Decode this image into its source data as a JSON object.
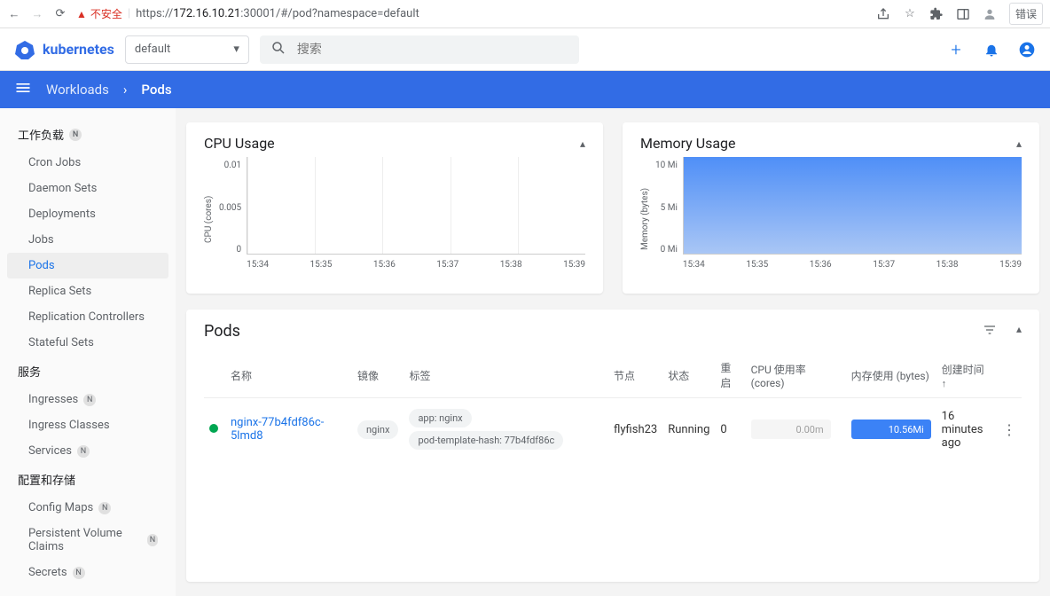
{
  "browser": {
    "insecure_label": "不安全",
    "url_prefix": "https://",
    "url_host": "172.16.10.21",
    "url_port_path": ":30001/#/pod?namespace=default",
    "error_btn": "错误"
  },
  "header": {
    "brand": "kubernetes",
    "namespace": "default",
    "search_placeholder": "搜索"
  },
  "breadcrumb": {
    "workloads": "Workloads",
    "current": "Pods"
  },
  "sidebar": {
    "sections": [
      {
        "title": "工作负载",
        "badge": "N",
        "items": [
          {
            "label": "Cron Jobs"
          },
          {
            "label": "Daemon Sets"
          },
          {
            "label": "Deployments"
          },
          {
            "label": "Jobs"
          },
          {
            "label": "Pods",
            "active": true
          },
          {
            "label": "Replica Sets"
          },
          {
            "label": "Replication Controllers"
          },
          {
            "label": "Stateful Sets"
          }
        ]
      },
      {
        "title": "服务",
        "items": [
          {
            "label": "Ingresses",
            "badge": "N"
          },
          {
            "label": "Ingress Classes"
          },
          {
            "label": "Services",
            "badge": "N"
          }
        ]
      },
      {
        "title": "配置和存储",
        "items": [
          {
            "label": "Config Maps",
            "badge": "N"
          },
          {
            "label": "Persistent Volume Claims",
            "badge": "N"
          },
          {
            "label": "Secrets",
            "badge": "N"
          }
        ]
      }
    ]
  },
  "chart_data": [
    {
      "type": "area",
      "title": "CPU Usage",
      "ylabel": "CPU (cores)",
      "x": [
        "15:34",
        "15:35",
        "15:36",
        "15:37",
        "15:38",
        "15:39"
      ],
      "y_ticks": [
        "0.01",
        "0.005",
        "0"
      ],
      "series": [
        {
          "name": "cpu",
          "values": [
            0,
            0,
            0,
            0,
            0,
            0
          ]
        }
      ],
      "ylim": [
        0,
        0.01
      ]
    },
    {
      "type": "area",
      "title": "Memory Usage",
      "ylabel": "Memory (bytes)",
      "x": [
        "15:34",
        "15:35",
        "15:36",
        "15:37",
        "15:38",
        "15:39"
      ],
      "y_ticks": [
        "10 Mi",
        "5 Mi",
        "0 Mi"
      ],
      "series": [
        {
          "name": "memory",
          "values": [
            10,
            10,
            10,
            10,
            10,
            10
          ]
        }
      ],
      "ylim": [
        0,
        10
      ]
    }
  ],
  "pods_table": {
    "title": "Pods",
    "headers": {
      "name": "名称",
      "image": "镜像",
      "labels": "标签",
      "node": "节点",
      "status": "状态",
      "restarts": "重启",
      "cpu": "CPU 使用率 (cores)",
      "mem": "内存使用 (bytes)",
      "created": "创建时间"
    },
    "rows": [
      {
        "name": "nginx-77b4fdf86c-5lmd8",
        "image": "nginx",
        "labels": [
          "app: nginx",
          "pod-template-hash: 77b4fdf86c"
        ],
        "node": "flyfish23",
        "status": "Running",
        "restarts": "0",
        "cpu": "0.00m",
        "mem": "10.56Mi",
        "created": "16 minutes ago"
      }
    ]
  }
}
